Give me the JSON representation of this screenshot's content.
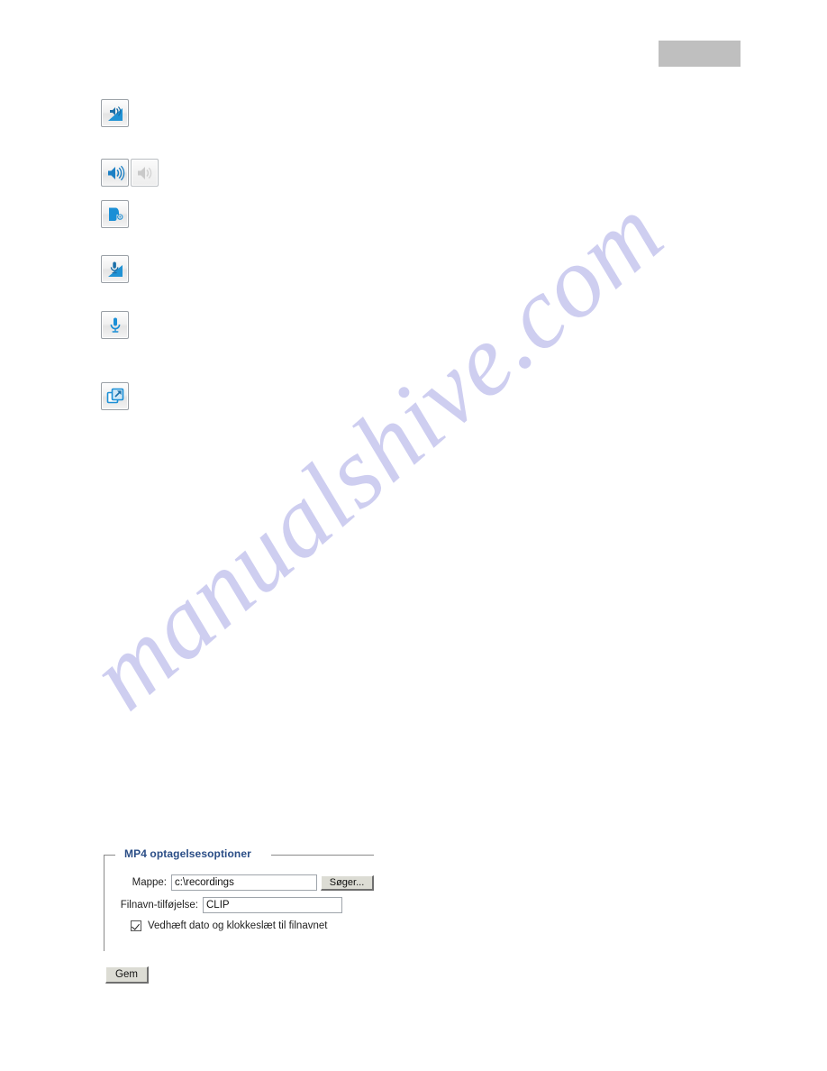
{
  "watermark": {
    "text": "manualshive.com"
  },
  "top_block": {
    "color": "#bfbfbf",
    "label": ""
  },
  "icon_buttons": [
    {
      "name": "volume-slider-icon",
      "title": "Volume slider"
    },
    {
      "name": "speaker-on-icon",
      "title": "Speaker on"
    },
    {
      "name": "speaker-off-icon",
      "title": "Speaker off"
    },
    {
      "name": "talk-icon",
      "title": "Talk"
    },
    {
      "name": "mic-volume-slider-icon",
      "title": "Microphone volume slider"
    },
    {
      "name": "microphone-icon",
      "title": "Microphone"
    },
    {
      "name": "fullscreen-icon",
      "title": "Full screen"
    }
  ],
  "settings": {
    "legend": "MP4 optagelsesoptioner",
    "folder": {
      "label": "Mappe:",
      "value": "c:\\recordings",
      "placeholder": "",
      "browse_button": "Søger..."
    },
    "suffix": {
      "label": "Filnavn-tilføjelse:",
      "value": "CLIP",
      "placeholder": ""
    },
    "append_datetime": {
      "label": "Vedhæft dato og klokkeslæt til filnavnet",
      "checked": true
    },
    "save_button": "Gem"
  },
  "colors": {
    "legend": "#2a4d86",
    "icon_blue": "#2092d4",
    "watermark": "#ccccf0",
    "button_face": "#dcdcd4"
  }
}
